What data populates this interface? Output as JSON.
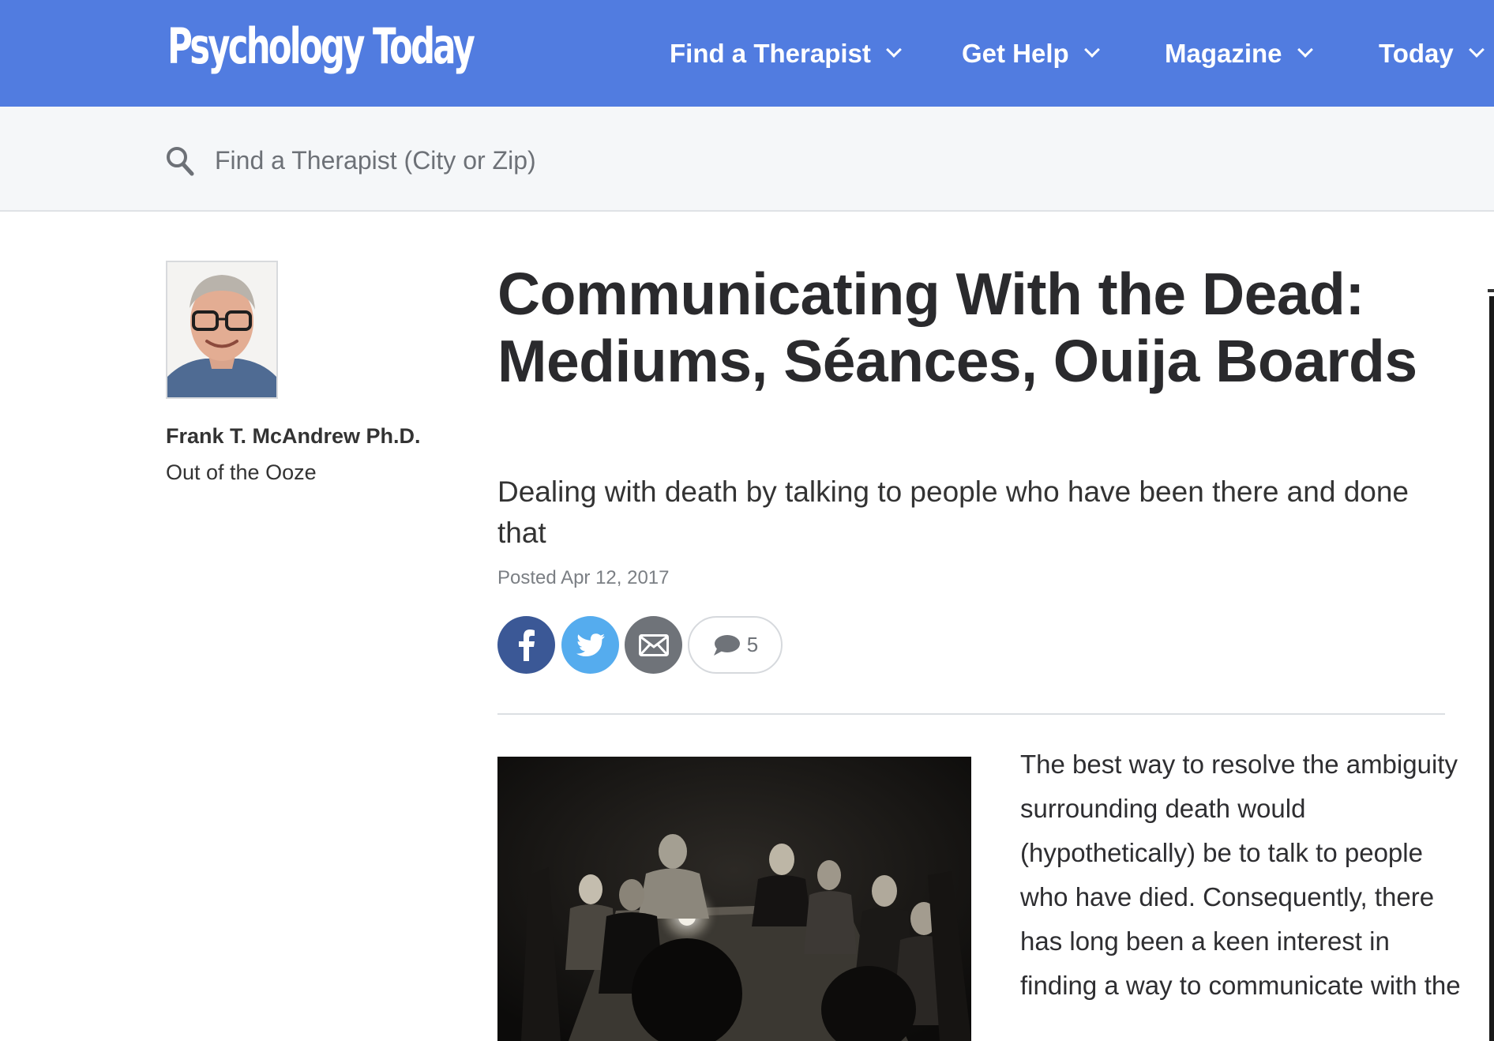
{
  "header": {
    "logo": "Psychology Today",
    "nav": [
      {
        "label": "Find a Therapist"
      },
      {
        "label": "Get Help"
      },
      {
        "label": "Magazine"
      },
      {
        "label": "Today"
      }
    ]
  },
  "search": {
    "placeholder": "Find a Therapist (City or Zip)",
    "value": ""
  },
  "author": {
    "name": "Frank T. McAndrew Ph.D.",
    "blog": "Out of the Ooze"
  },
  "article": {
    "title": "Communicating With the Dead: Mediums, Séances, Ouija Boards",
    "subtitle": "Dealing with death by talking to people who have been there and done that",
    "posted": "Posted Apr 12, 2017",
    "comment_count": "5",
    "body": "The best way to resolve the ambiguity surrounding death would (hypothetically) be to talk to people who have died. Consequently, there has long been a keen interest in finding a way to communicate with the"
  },
  "colors": {
    "brand": "#517ce0",
    "facebook": "#3b5896",
    "twitter": "#55acee",
    "email": "#6f7379"
  },
  "icons": [
    "search-icon",
    "chevron-down-icon",
    "facebook-icon",
    "twitter-icon",
    "email-icon",
    "comment-icon"
  ]
}
